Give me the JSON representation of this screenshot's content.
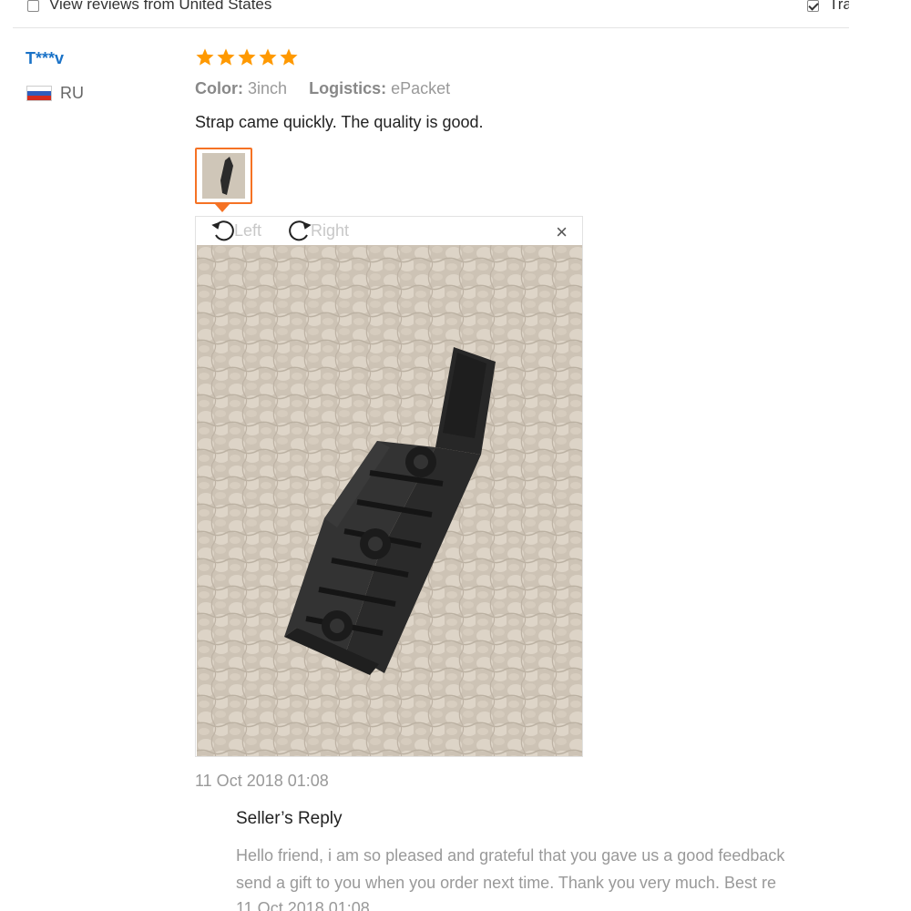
{
  "filters": {
    "view_local_label": "View reviews from United States",
    "view_local_checked": false,
    "translate_label": "Tra",
    "translate_checked": true
  },
  "review": {
    "reviewer_name": "T***v",
    "country_code": "RU",
    "rating": 5,
    "color_key": "Color:",
    "color_value": "3inch",
    "logistics_key": "Logistics:",
    "logistics_value": "ePacket",
    "text": "Strap came quickly. The quality is good.",
    "date": "11 Oct 2018 01:08",
    "star_color": "#ff9900",
    "accent_color": "#f57224",
    "name_color": "#1a72c7"
  },
  "viewer": {
    "rotate_left_label": "Left",
    "rotate_right_label": "Right",
    "close_label": "×"
  },
  "seller_reply": {
    "title": "Seller’s Reply",
    "line1": "Hello friend, i am so pleased and grateful that you gave us a good feedback",
    "line2": "send a gift to you when you order next time. Thank you very much. Best re",
    "date": "11 Oct 2018 01:08"
  }
}
